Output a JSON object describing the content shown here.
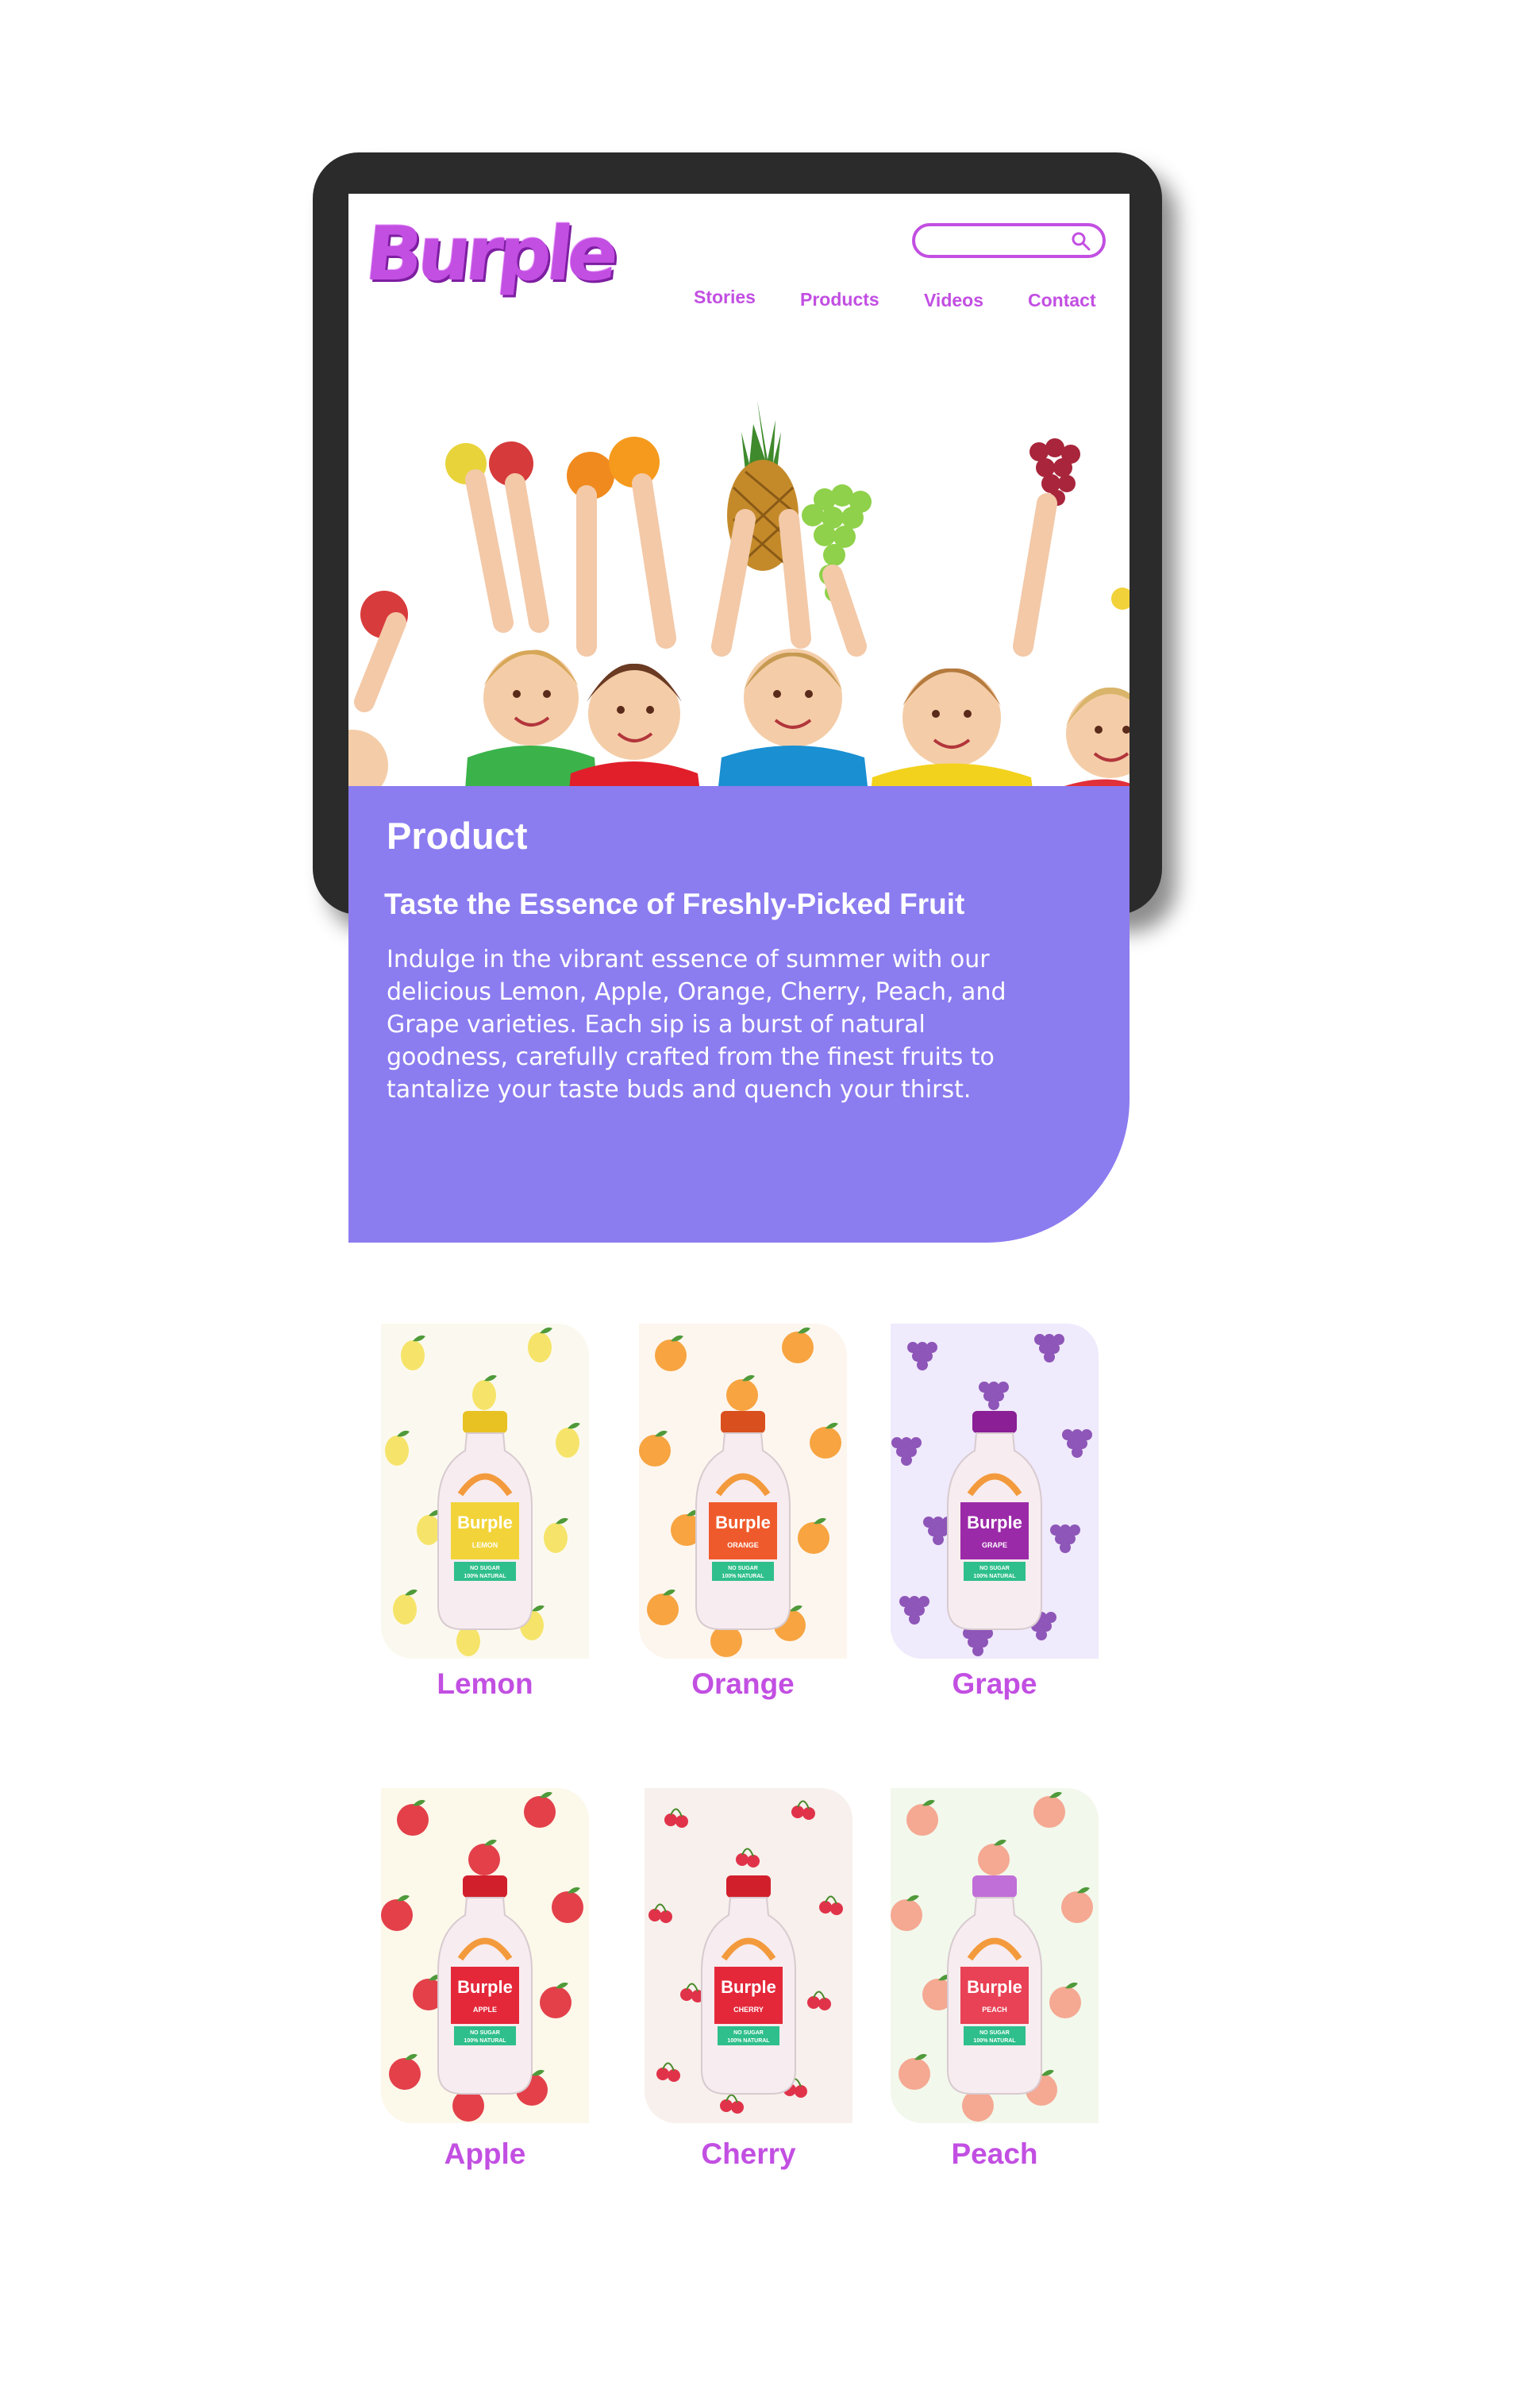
{
  "brand": {
    "name": "Burple",
    "color": "#c24fe2"
  },
  "search": {
    "placeholder": ""
  },
  "nav": {
    "items": [
      {
        "label": "Stories"
      },
      {
        "label": "Products"
      },
      {
        "label": "Videos"
      },
      {
        "label": "Contact"
      }
    ]
  },
  "hero": {
    "image": "children-holding-fruits-photo"
  },
  "card": {
    "title": "Product",
    "subtitle": "Taste the Essence of Freshly-Picked Fruit",
    "body_lines": [
      "Indulge in the vibrant essence of summer with our",
      "delicious Lemon, Apple, Orange, Cherry, Peach, and",
      "Grape varieties. Each sip is a burst of natural",
      "goodness, carefully crafted from the finest fruits to",
      "tantalize your taste buds and quench your thirst."
    ],
    "color": "#8b7cf0"
  },
  "products": [
    {
      "name": "Lemon",
      "bottle_label": "LEMON",
      "bg": "#fbf9ef",
      "accent": "#f2d43a",
      "fruit": "#f6e46a",
      "cap": "#e8c223"
    },
    {
      "name": "Orange",
      "bottle_label": "ORANGE",
      "bg": "#fdf6ee",
      "accent": "#ef5a2c",
      "fruit": "#f7a441",
      "cap": "#d9501e"
    },
    {
      "name": "Grape",
      "bottle_label": "GRAPE",
      "bg": "#efeafc",
      "accent": "#9b2aa8",
      "fruit": "#8e56b8",
      "cap": "#8a1f96"
    },
    {
      "name": "Apple",
      "bottle_label": "APPLE",
      "bg": "#fcf8ea",
      "accent": "#e4283a",
      "fruit": "#e3404a",
      "cap": "#d21f2c"
    },
    {
      "name": "Cherry",
      "bottle_label": "CHERRY",
      "bg": "#f7f0ec",
      "accent": "#e4283a",
      "fruit": "#e0334a",
      "cap": "#d21f2c"
    },
    {
      "name": "Peach",
      "bottle_label": "PEACH",
      "bg": "#f2f8ec",
      "accent": "#e94155",
      "fruit": "#f5a892",
      "cap": "#c06fd8"
    }
  ],
  "bottle": {
    "tagline_1": "NO SUGAR",
    "tagline_2": "100% NATURAL"
  }
}
